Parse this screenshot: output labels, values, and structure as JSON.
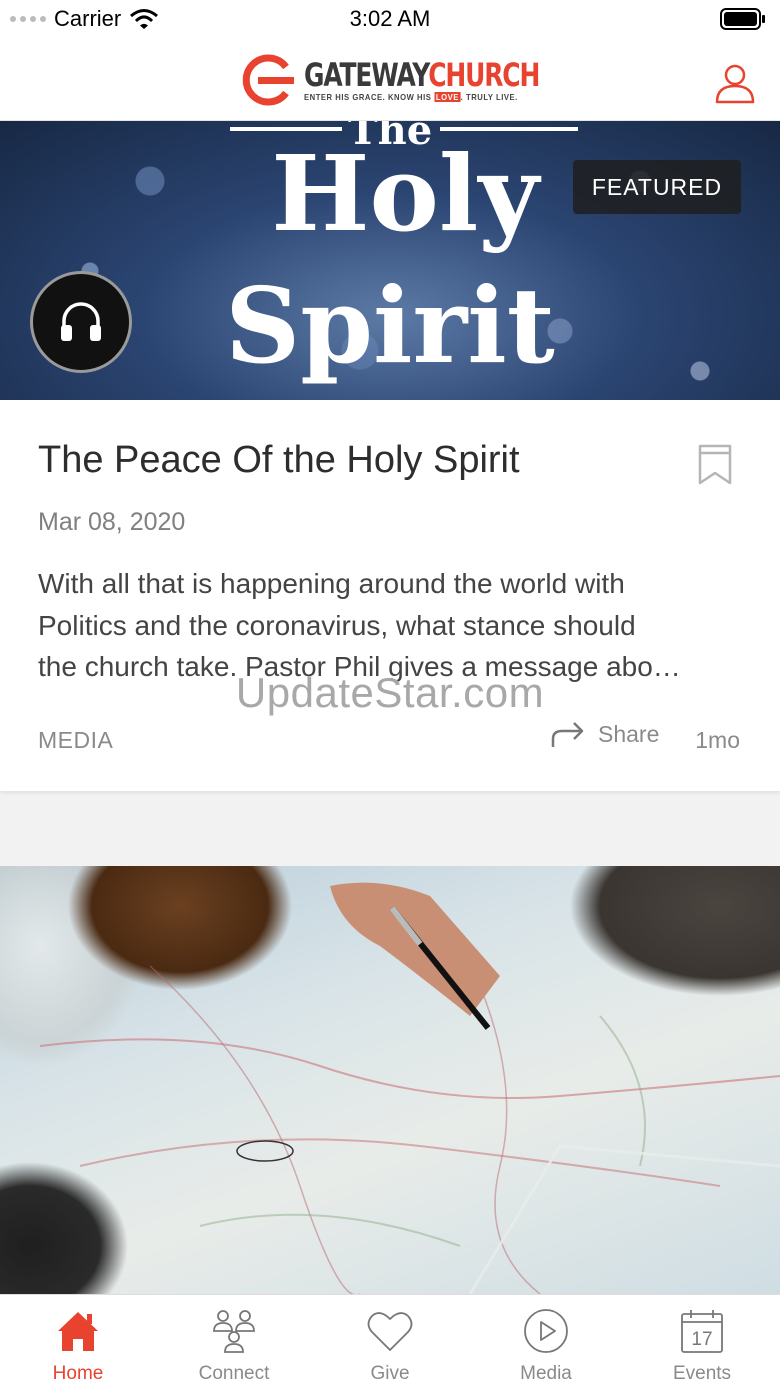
{
  "status_bar": {
    "carrier": "Carrier",
    "time": "3:02 AM"
  },
  "header": {
    "logo_main_left": "GATEWAY",
    "logo_main_right": "CHURCH",
    "logo_tagline_a": "ENTER HIS GRACE.  KNOW HIS ",
    "logo_tagline_love": "LOVE",
    "logo_tagline_b": ".  TRULY LIVE.",
    "profile_icon": "user-icon"
  },
  "featured_card": {
    "hero": {
      "title_line1": "The",
      "title_line2": "Holy",
      "title_line3": "Spirit"
    },
    "badge": "FEATURED",
    "audio_icon": "headphones-icon",
    "title": "The Peace Of the Holy Spirit",
    "date": "Mar 08, 2020",
    "description_lines": [
      "With all that is happening around the world with",
      "Politics and the coronavirus, what stance should",
      "the church take. Pastor Phil gives a message abo…"
    ],
    "category": "MEDIA",
    "share_label": "Share",
    "age": "1mo"
  },
  "watermark": "UpdateStar.com",
  "tab_bar": {
    "tabs": [
      {
        "label": "Home",
        "icon": "home-icon",
        "active": true
      },
      {
        "label": "Connect",
        "icon": "people-icon",
        "active": false
      },
      {
        "label": "Give",
        "icon": "heart-icon",
        "active": false
      },
      {
        "label": "Media",
        "icon": "play-icon",
        "active": false
      },
      {
        "label": "Events",
        "icon": "calendar-icon",
        "active": false,
        "calendar_day": "17"
      }
    ]
  },
  "colors": {
    "brand_red": "#e8432f",
    "tab_inactive": "#8a8a8a"
  }
}
